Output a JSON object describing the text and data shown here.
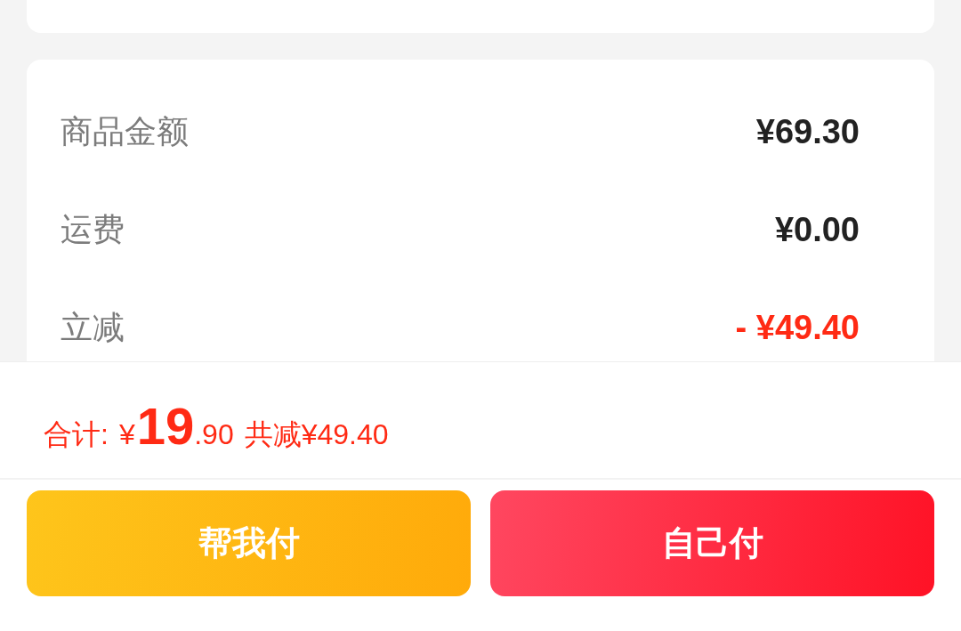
{
  "summary": {
    "rows": [
      {
        "kind": "amount",
        "label": "商品金额",
        "value": "¥69.30"
      },
      {
        "kind": "amount",
        "label": "运费",
        "value": "¥0.00"
      },
      {
        "kind": "discount",
        "label": "立减",
        "value": "- ¥49.40"
      }
    ]
  },
  "total_bar": {
    "label": "合计:",
    "currency": "¥",
    "integer": "19",
    "decimal": ".90",
    "savings": "共减¥49.40"
  },
  "buttons": [
    {
      "kind": "secondary",
      "label": "帮我付"
    },
    {
      "kind": "primary",
      "label": "自己付"
    }
  ]
}
